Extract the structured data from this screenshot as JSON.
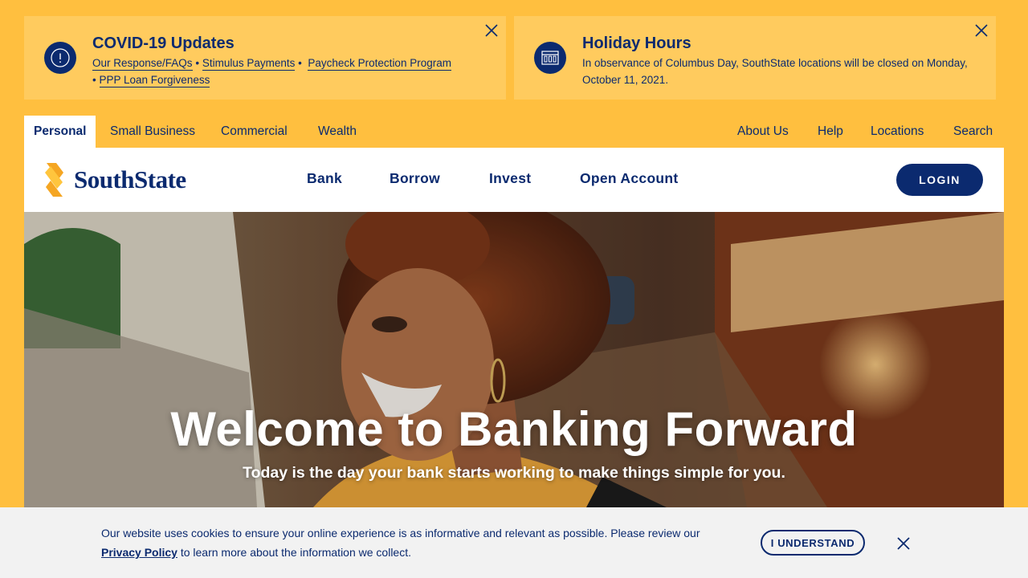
{
  "alerts": {
    "covid": {
      "title": "COVID-19 Updates",
      "links": [
        "Our Response/FAQs",
        "Stimulus Payments",
        "Paycheck Protection Program",
        "PPP Loan Forgiveness"
      ],
      "separator": "•",
      "icon": "alert-circle-icon"
    },
    "holiday": {
      "title": "Holiday Hours",
      "text": "In observance of Columbus Day, SouthState locations will be closed on Monday, October 11, 2021.",
      "icon": "bank-building-icon"
    }
  },
  "segments": {
    "left": [
      "Personal",
      "Small Business",
      "Commercial",
      "Wealth"
    ],
    "right": [
      "About Us",
      "Help",
      "Locations",
      "Search"
    ],
    "active": "Personal"
  },
  "header": {
    "brand": "SouthState",
    "nav": [
      "Bank",
      "Borrow",
      "Invest",
      "Open Account"
    ],
    "login": "LOGIN"
  },
  "hero": {
    "title": "Welcome to Banking Forward",
    "subtitle": "Today is the day your bank starts working to make things simple for you."
  },
  "cookie": {
    "message_before": "Our website uses cookies to ensure your online experience is as informative and relevant as possible. Please review our",
    "link": "Privacy Policy",
    "message_after": "to learn more about the information we collect.",
    "button": "I UNDERSTAND"
  },
  "colors": {
    "brand_gold": "#FFBF3F",
    "alert_gold": "#FFCB5E",
    "navy": "#0B2A6F",
    "white": "#FFFFFF",
    "cookie_bg": "#F2F2F2"
  }
}
